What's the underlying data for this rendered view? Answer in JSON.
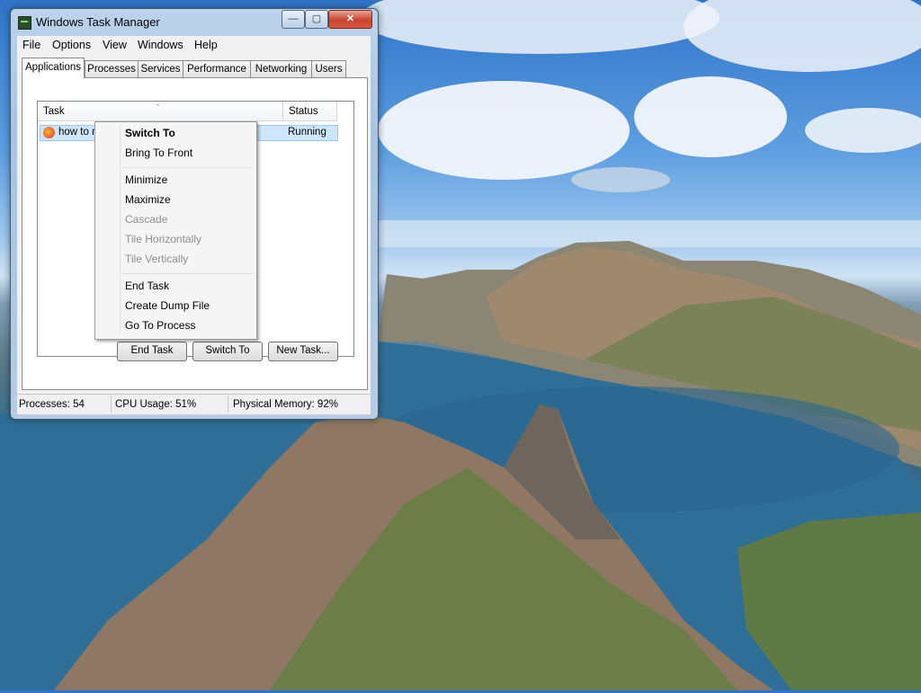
{
  "window": {
    "title": "Windows Task Manager",
    "controls": {
      "minimize": "—",
      "maximize": "▢",
      "close": "✕"
    }
  },
  "menubar": [
    "File",
    "Options",
    "View",
    "Windows",
    "Help"
  ],
  "tabs": [
    {
      "label": "Applications",
      "active": true
    },
    {
      "label": "Processes",
      "active": false
    },
    {
      "label": "Services",
      "active": false
    },
    {
      "label": "Performance",
      "active": false
    },
    {
      "label": "Networking",
      "active": false
    },
    {
      "label": "Users",
      "active": false
    }
  ],
  "task_list": {
    "columns": [
      "Task",
      "Status"
    ],
    "sort_indicator": "ˆ",
    "rows": [
      {
        "task": "how to m…                            …",
        "status": "Running",
        "icon": "firefox-icon"
      }
    ]
  },
  "buttons": {
    "end_task": "End Task",
    "switch_to": "Switch To",
    "new_task": "New Task..."
  },
  "statusbar": {
    "processes": "Processes: 54",
    "cpu": "CPU Usage: 51%",
    "memory": "Physical Memory: 92%"
  },
  "context_menu": [
    {
      "label": "Switch To",
      "bold": true,
      "enabled": true
    },
    {
      "label": "Bring To Front",
      "enabled": true
    },
    {
      "label": "Minimize",
      "enabled": true
    },
    {
      "label": "Maximize",
      "enabled": true
    },
    {
      "label": "Cascade",
      "enabled": false
    },
    {
      "label": "Tile Horizontally",
      "enabled": false
    },
    {
      "label": "Tile Vertically",
      "enabled": false
    },
    {
      "label": "End Task",
      "enabled": true
    },
    {
      "label": "Create Dump File",
      "enabled": true
    },
    {
      "label": "Go To Process",
      "enabled": true
    }
  ],
  "colors": {
    "selection": "#cde6fb",
    "close_button": "#c7442d",
    "window_frame": "#a9c4e0"
  }
}
